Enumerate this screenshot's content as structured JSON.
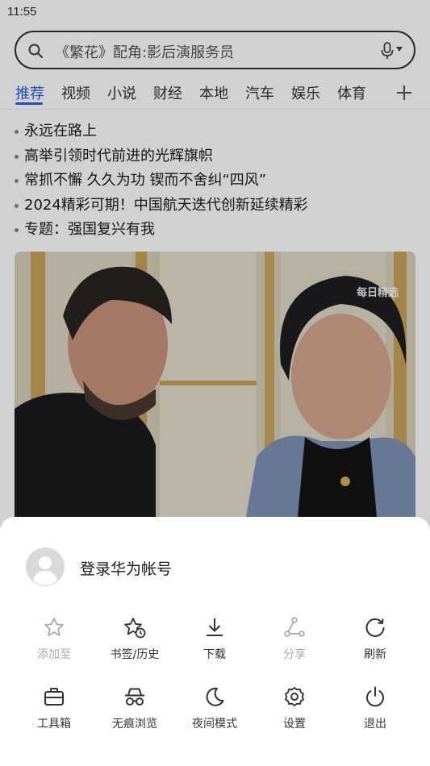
{
  "status_bar": {
    "time": "11:55"
  },
  "search": {
    "query": "《繁花》配角:影后演服务员"
  },
  "tabs": [
    "推荐",
    "视频",
    "小说",
    "财经",
    "本地",
    "汽车",
    "娱乐",
    "体育"
  ],
  "headlines": [
    "永远在路上",
    "高举引领时代前进的光辉旗帜",
    "常抓不懈 久久为功 锲而不舍纠“四风”",
    "2024精彩可期！中国航天迭代创新延续精彩",
    "专题：强国复兴有我"
  ],
  "photo": {
    "watermark": "每日精选"
  },
  "menu": {
    "login_label": "登录华为帐号",
    "row1": [
      {
        "label": "添加至",
        "icon": "star-outline-icon",
        "enabled": false
      },
      {
        "label": "书签/历史",
        "icon": "bookmark-history-icon",
        "enabled": true
      },
      {
        "label": "下载",
        "icon": "download-icon",
        "enabled": true
      },
      {
        "label": "分享",
        "icon": "share-icon",
        "enabled": false
      },
      {
        "label": "刷新",
        "icon": "refresh-icon",
        "enabled": true
      }
    ],
    "row2": [
      {
        "label": "工具箱",
        "icon": "toolbox-icon",
        "enabled": true
      },
      {
        "label": "无痕浏览",
        "icon": "incognito-icon",
        "enabled": true
      },
      {
        "label": "夜间模式",
        "icon": "moon-icon",
        "enabled": true
      },
      {
        "label": "设置",
        "icon": "gear-icon",
        "enabled": true
      },
      {
        "label": "退出",
        "icon": "power-icon",
        "enabled": true
      }
    ]
  },
  "colors": {
    "accent": "#2a5fe0",
    "disabled": "#aaaaaa"
  }
}
